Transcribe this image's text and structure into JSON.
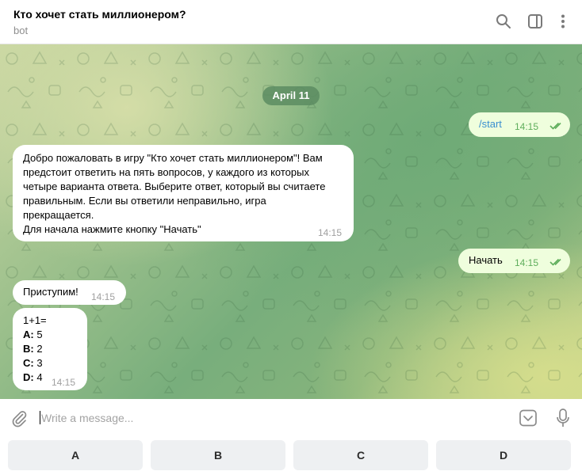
{
  "header": {
    "title": "Кто хочет стать миллионером?",
    "subtitle": "bot",
    "icons": [
      "search-icon",
      "sidebar-toggle-icon",
      "more-vert-icon"
    ]
  },
  "chat": {
    "date": "April 11",
    "messages": [
      {
        "direction": "outgoing",
        "text": "/start",
        "time": "14:15",
        "status": "read"
      },
      {
        "direction": "incoming",
        "lines": [
          "Добро пожаловать в игру \"Кто хочет стать миллионером\"! Вам",
          "предстоит ответить на пять вопросов, у каждого из которых",
          "четыре варианта ответа. Выберите ответ, который вы считаете",
          "правильным. Если вы ответили неправильно, игра",
          "прекращается.",
          "Для начала нажмите кнопку \"Начать\""
        ],
        "time": "14:15"
      },
      {
        "direction": "outgoing",
        "text": "Начать",
        "time": "14:15",
        "status": "read"
      },
      {
        "direction": "incoming",
        "text": "Приступим!",
        "time": "14:15"
      },
      {
        "direction": "incoming",
        "question": "1+1=",
        "options": [
          {
            "letter": "A:",
            "value": "5"
          },
          {
            "letter": "B:",
            "value": "2"
          },
          {
            "letter": "C:",
            "value": "3"
          },
          {
            "letter": "D:",
            "value": "4"
          }
        ],
        "time": "14:15"
      }
    ]
  },
  "composer": {
    "placeholder": "Write a message...",
    "icons": [
      "attach-icon",
      "keyboard-icon",
      "microphone-icon"
    ]
  },
  "reply_keyboard": [
    "A",
    "B",
    "C",
    "D"
  ],
  "colors": {
    "outgoing_bubble": "#effedd",
    "incoming_bubble": "#ffffff",
    "read_check": "#5fae5c",
    "date_pill": "#5c8c62",
    "key_background": "#eef0f2"
  }
}
